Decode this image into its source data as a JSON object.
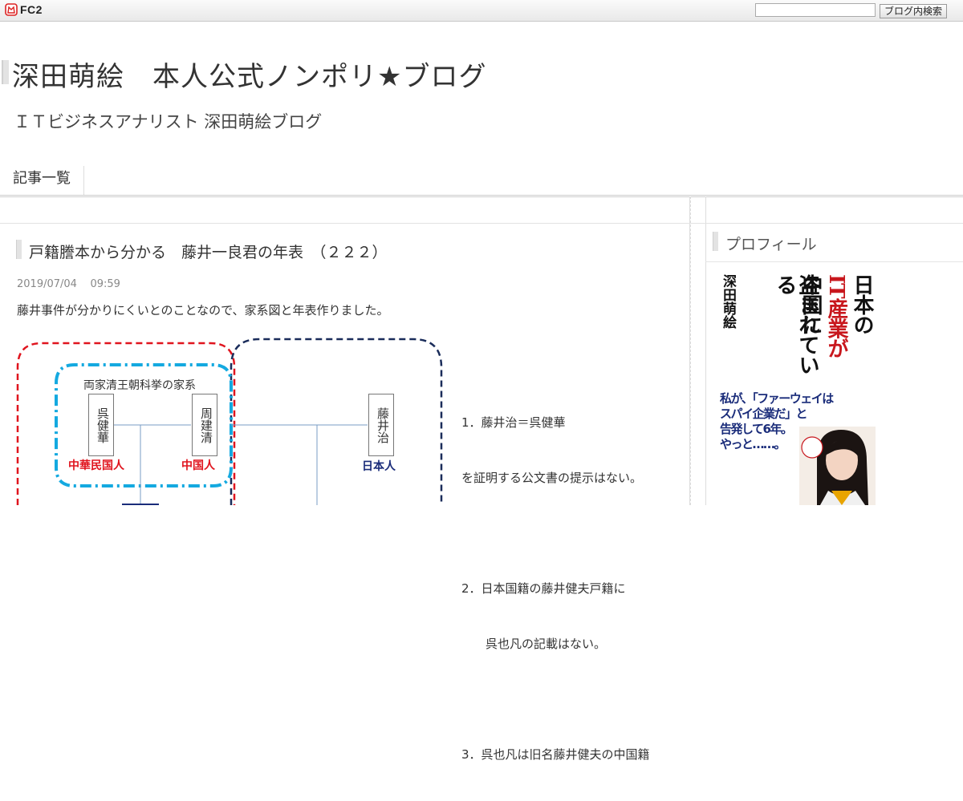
{
  "topbar": {
    "logo_text": "FC2",
    "search_value": "",
    "search_button": "ブログ内検索"
  },
  "header": {
    "title": "深田萌絵　本人公式ノンポリ★ブログ",
    "subtitle": "ＩＴビジネスアナリスト 深田萌絵ブログ"
  },
  "nav": {
    "items": [
      {
        "label": "記事一覧"
      }
    ]
  },
  "entry": {
    "title": "戸籍謄本から分かる　藤井一良君の年表　（２２２）",
    "date": "2019/07/04",
    "time": "09:59",
    "lead": "藤井事件が分かりにくいとのことなので、家系図と年表作りました。"
  },
  "diagram": {
    "family_title": "両家清王朝科挙の家系",
    "persons": [
      {
        "name": "呉健華",
        "nationality": "中華民国人",
        "color": "#e0141e"
      },
      {
        "name": "周建清",
        "nationality": "中国人",
        "color": "#e0141e"
      },
      {
        "name": "藤井治",
        "nationality": "日本人",
        "color": "#1a2c7a"
      }
    ],
    "notes": [
      "1．藤井治＝呉健華",
      "を証明する公文書の提示はない。",
      "",
      "2．日本国籍の藤井健夫戸籍に",
      "　　呉也凡の記載はない。",
      "",
      "3．呉也凡は旧名藤井健夫の中国籍"
    ],
    "colors": {
      "red_dash": "#e0141e",
      "blue_dashdot": "#14a9e0",
      "navy_dash": "#1a2c5a"
    }
  },
  "sidebar": {
    "profile_heading": "プロフィール",
    "book": {
      "author": "深田萌絵",
      "title_lines": [
        "日本の",
        "IT産業が",
        "中国に",
        "盗まれている"
      ],
      "catch_line1": "私が、「ファーウェイは",
      "catch_line2": "スパイ企業だ」と",
      "catch_line3": "告発して6年。",
      "catch_line4": "やっと……。"
    }
  }
}
